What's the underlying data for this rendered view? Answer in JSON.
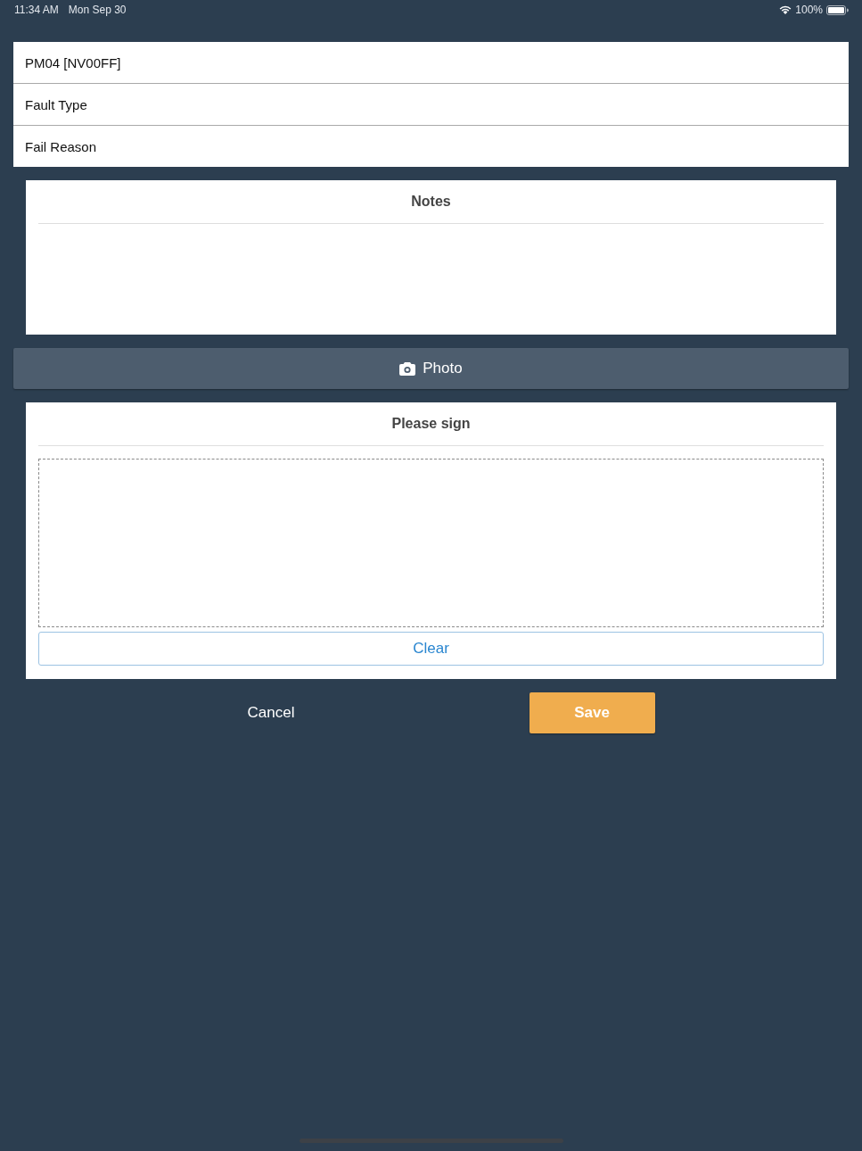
{
  "status_bar": {
    "time": "11:34 AM",
    "date": "Mon Sep 30",
    "battery": "100%"
  },
  "fields": [
    {
      "label": "PM04 [NV00FF]"
    },
    {
      "label": "Fault Type"
    },
    {
      "label": "Fail Reason"
    }
  ],
  "notes": {
    "title": "Notes"
  },
  "photo_button": {
    "label": "Photo"
  },
  "signature": {
    "title": "Please sign",
    "clear_button": "Clear"
  },
  "actions": {
    "cancel": "Cancel",
    "save": "Save"
  }
}
